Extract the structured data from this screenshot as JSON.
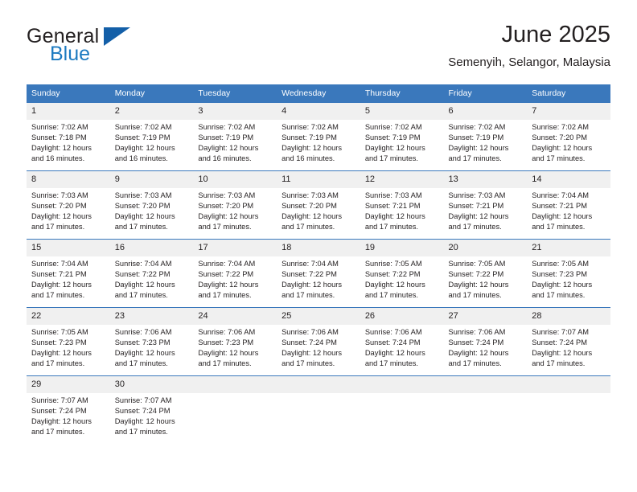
{
  "logo": {
    "word_top": "General",
    "word_bottom": "Blue",
    "triangle_color": "#135fa8",
    "blue_color": "#1c7ac0"
  },
  "header": {
    "title": "June 2025",
    "subtitle": "Semenyih, Selangor, Malaysia"
  },
  "theme": {
    "header_blue": "#3a78bc",
    "daynum_band": "#f0f0f0",
    "text": "#231f20"
  },
  "calendar": {
    "weekday_headers": [
      "Sunday",
      "Monday",
      "Tuesday",
      "Wednesday",
      "Thursday",
      "Friday",
      "Saturday"
    ],
    "weeks": [
      [
        {
          "day": "1",
          "sunrise": "Sunrise: 7:02 AM",
          "sunset": "Sunset: 7:18 PM",
          "daylight_line1": "Daylight: 12 hours",
          "daylight_line2": "and 16 minutes."
        },
        {
          "day": "2",
          "sunrise": "Sunrise: 7:02 AM",
          "sunset": "Sunset: 7:19 PM",
          "daylight_line1": "Daylight: 12 hours",
          "daylight_line2": "and 16 minutes."
        },
        {
          "day": "3",
          "sunrise": "Sunrise: 7:02 AM",
          "sunset": "Sunset: 7:19 PM",
          "daylight_line1": "Daylight: 12 hours",
          "daylight_line2": "and 16 minutes."
        },
        {
          "day": "4",
          "sunrise": "Sunrise: 7:02 AM",
          "sunset": "Sunset: 7:19 PM",
          "daylight_line1": "Daylight: 12 hours",
          "daylight_line2": "and 16 minutes."
        },
        {
          "day": "5",
          "sunrise": "Sunrise: 7:02 AM",
          "sunset": "Sunset: 7:19 PM",
          "daylight_line1": "Daylight: 12 hours",
          "daylight_line2": "and 17 minutes."
        },
        {
          "day": "6",
          "sunrise": "Sunrise: 7:02 AM",
          "sunset": "Sunset: 7:19 PM",
          "daylight_line1": "Daylight: 12 hours",
          "daylight_line2": "and 17 minutes."
        },
        {
          "day": "7",
          "sunrise": "Sunrise: 7:02 AM",
          "sunset": "Sunset: 7:20 PM",
          "daylight_line1": "Daylight: 12 hours",
          "daylight_line2": "and 17 minutes."
        }
      ],
      [
        {
          "day": "8",
          "sunrise": "Sunrise: 7:03 AM",
          "sunset": "Sunset: 7:20 PM",
          "daylight_line1": "Daylight: 12 hours",
          "daylight_line2": "and 17 minutes."
        },
        {
          "day": "9",
          "sunrise": "Sunrise: 7:03 AM",
          "sunset": "Sunset: 7:20 PM",
          "daylight_line1": "Daylight: 12 hours",
          "daylight_line2": "and 17 minutes."
        },
        {
          "day": "10",
          "sunrise": "Sunrise: 7:03 AM",
          "sunset": "Sunset: 7:20 PM",
          "daylight_line1": "Daylight: 12 hours",
          "daylight_line2": "and 17 minutes."
        },
        {
          "day": "11",
          "sunrise": "Sunrise: 7:03 AM",
          "sunset": "Sunset: 7:20 PM",
          "daylight_line1": "Daylight: 12 hours",
          "daylight_line2": "and 17 minutes."
        },
        {
          "day": "12",
          "sunrise": "Sunrise: 7:03 AM",
          "sunset": "Sunset: 7:21 PM",
          "daylight_line1": "Daylight: 12 hours",
          "daylight_line2": "and 17 minutes."
        },
        {
          "day": "13",
          "sunrise": "Sunrise: 7:03 AM",
          "sunset": "Sunset: 7:21 PM",
          "daylight_line1": "Daylight: 12 hours",
          "daylight_line2": "and 17 minutes."
        },
        {
          "day": "14",
          "sunrise": "Sunrise: 7:04 AM",
          "sunset": "Sunset: 7:21 PM",
          "daylight_line1": "Daylight: 12 hours",
          "daylight_line2": "and 17 minutes."
        }
      ],
      [
        {
          "day": "15",
          "sunrise": "Sunrise: 7:04 AM",
          "sunset": "Sunset: 7:21 PM",
          "daylight_line1": "Daylight: 12 hours",
          "daylight_line2": "and 17 minutes."
        },
        {
          "day": "16",
          "sunrise": "Sunrise: 7:04 AM",
          "sunset": "Sunset: 7:22 PM",
          "daylight_line1": "Daylight: 12 hours",
          "daylight_line2": "and 17 minutes."
        },
        {
          "day": "17",
          "sunrise": "Sunrise: 7:04 AM",
          "sunset": "Sunset: 7:22 PM",
          "daylight_line1": "Daylight: 12 hours",
          "daylight_line2": "and 17 minutes."
        },
        {
          "day": "18",
          "sunrise": "Sunrise: 7:04 AM",
          "sunset": "Sunset: 7:22 PM",
          "daylight_line1": "Daylight: 12 hours",
          "daylight_line2": "and 17 minutes."
        },
        {
          "day": "19",
          "sunrise": "Sunrise: 7:05 AM",
          "sunset": "Sunset: 7:22 PM",
          "daylight_line1": "Daylight: 12 hours",
          "daylight_line2": "and 17 minutes."
        },
        {
          "day": "20",
          "sunrise": "Sunrise: 7:05 AM",
          "sunset": "Sunset: 7:22 PM",
          "daylight_line1": "Daylight: 12 hours",
          "daylight_line2": "and 17 minutes."
        },
        {
          "day": "21",
          "sunrise": "Sunrise: 7:05 AM",
          "sunset": "Sunset: 7:23 PM",
          "daylight_line1": "Daylight: 12 hours",
          "daylight_line2": "and 17 minutes."
        }
      ],
      [
        {
          "day": "22",
          "sunrise": "Sunrise: 7:05 AM",
          "sunset": "Sunset: 7:23 PM",
          "daylight_line1": "Daylight: 12 hours",
          "daylight_line2": "and 17 minutes."
        },
        {
          "day": "23",
          "sunrise": "Sunrise: 7:06 AM",
          "sunset": "Sunset: 7:23 PM",
          "daylight_line1": "Daylight: 12 hours",
          "daylight_line2": "and 17 minutes."
        },
        {
          "day": "24",
          "sunrise": "Sunrise: 7:06 AM",
          "sunset": "Sunset: 7:23 PM",
          "daylight_line1": "Daylight: 12 hours",
          "daylight_line2": "and 17 minutes."
        },
        {
          "day": "25",
          "sunrise": "Sunrise: 7:06 AM",
          "sunset": "Sunset: 7:24 PM",
          "daylight_line1": "Daylight: 12 hours",
          "daylight_line2": "and 17 minutes."
        },
        {
          "day": "26",
          "sunrise": "Sunrise: 7:06 AM",
          "sunset": "Sunset: 7:24 PM",
          "daylight_line1": "Daylight: 12 hours",
          "daylight_line2": "and 17 minutes."
        },
        {
          "day": "27",
          "sunrise": "Sunrise: 7:06 AM",
          "sunset": "Sunset: 7:24 PM",
          "daylight_line1": "Daylight: 12 hours",
          "daylight_line2": "and 17 minutes."
        },
        {
          "day": "28",
          "sunrise": "Sunrise: 7:07 AM",
          "sunset": "Sunset: 7:24 PM",
          "daylight_line1": "Daylight: 12 hours",
          "daylight_line2": "and 17 minutes."
        }
      ],
      [
        {
          "day": "29",
          "sunrise": "Sunrise: 7:07 AM",
          "sunset": "Sunset: 7:24 PM",
          "daylight_line1": "Daylight: 12 hours",
          "daylight_line2": "and 17 minutes."
        },
        {
          "day": "30",
          "sunrise": "Sunrise: 7:07 AM",
          "sunset": "Sunset: 7:24 PM",
          "daylight_line1": "Daylight: 12 hours",
          "daylight_line2": "and 17 minutes."
        },
        {
          "day": "",
          "sunrise": "",
          "sunset": "",
          "daylight_line1": "",
          "daylight_line2": ""
        },
        {
          "day": "",
          "sunrise": "",
          "sunset": "",
          "daylight_line1": "",
          "daylight_line2": ""
        },
        {
          "day": "",
          "sunrise": "",
          "sunset": "",
          "daylight_line1": "",
          "daylight_line2": ""
        },
        {
          "day": "",
          "sunrise": "",
          "sunset": "",
          "daylight_line1": "",
          "daylight_line2": ""
        },
        {
          "day": "",
          "sunrise": "",
          "sunset": "",
          "daylight_line1": "",
          "daylight_line2": ""
        }
      ]
    ]
  }
}
